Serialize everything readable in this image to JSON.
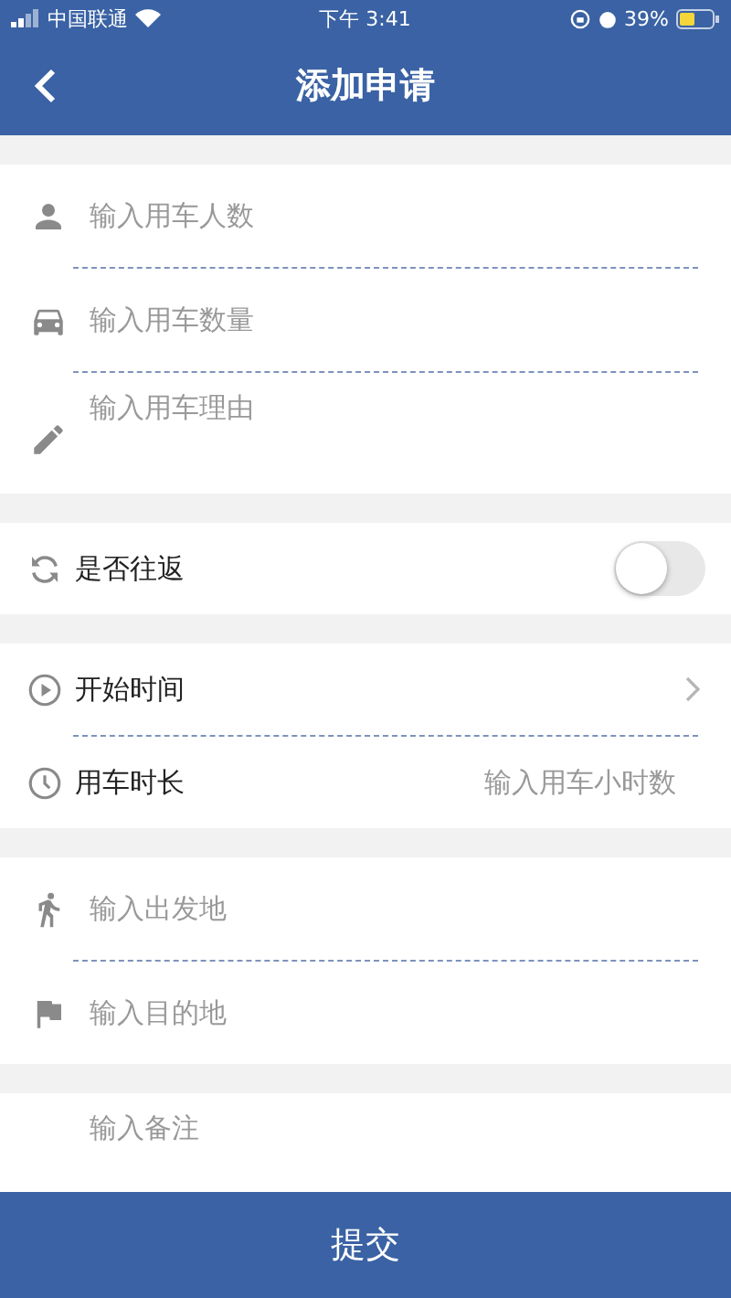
{
  "status_bar": {
    "carrier": "中国联通",
    "time": "下午 3:41",
    "battery": "39%"
  },
  "nav": {
    "title": "添加申请"
  },
  "sections": [
    {
      "rows": [
        {
          "kind": "input",
          "placeholder": "输入用车人数"
        },
        {
          "kind": "input",
          "placeholder": "输入用车数量"
        },
        {
          "kind": "textarea",
          "placeholder": "输入用车理由"
        }
      ]
    },
    {
      "rows": [
        {
          "kind": "toggle",
          "label": "是否往返",
          "on": false
        }
      ]
    },
    {
      "rows": [
        {
          "kind": "picker",
          "label": "开始时间"
        },
        {
          "kind": "labeled-input",
          "label": "用车时长",
          "placeholder": "输入用车小时数"
        }
      ]
    },
    {
      "rows": [
        {
          "kind": "input",
          "placeholder": "输入出发地"
        },
        {
          "kind": "input",
          "placeholder": "输入目的地"
        }
      ]
    },
    {
      "rows": [
        {
          "kind": "textarea",
          "placeholder": "输入备注"
        }
      ]
    }
  ],
  "submit": "提交"
}
